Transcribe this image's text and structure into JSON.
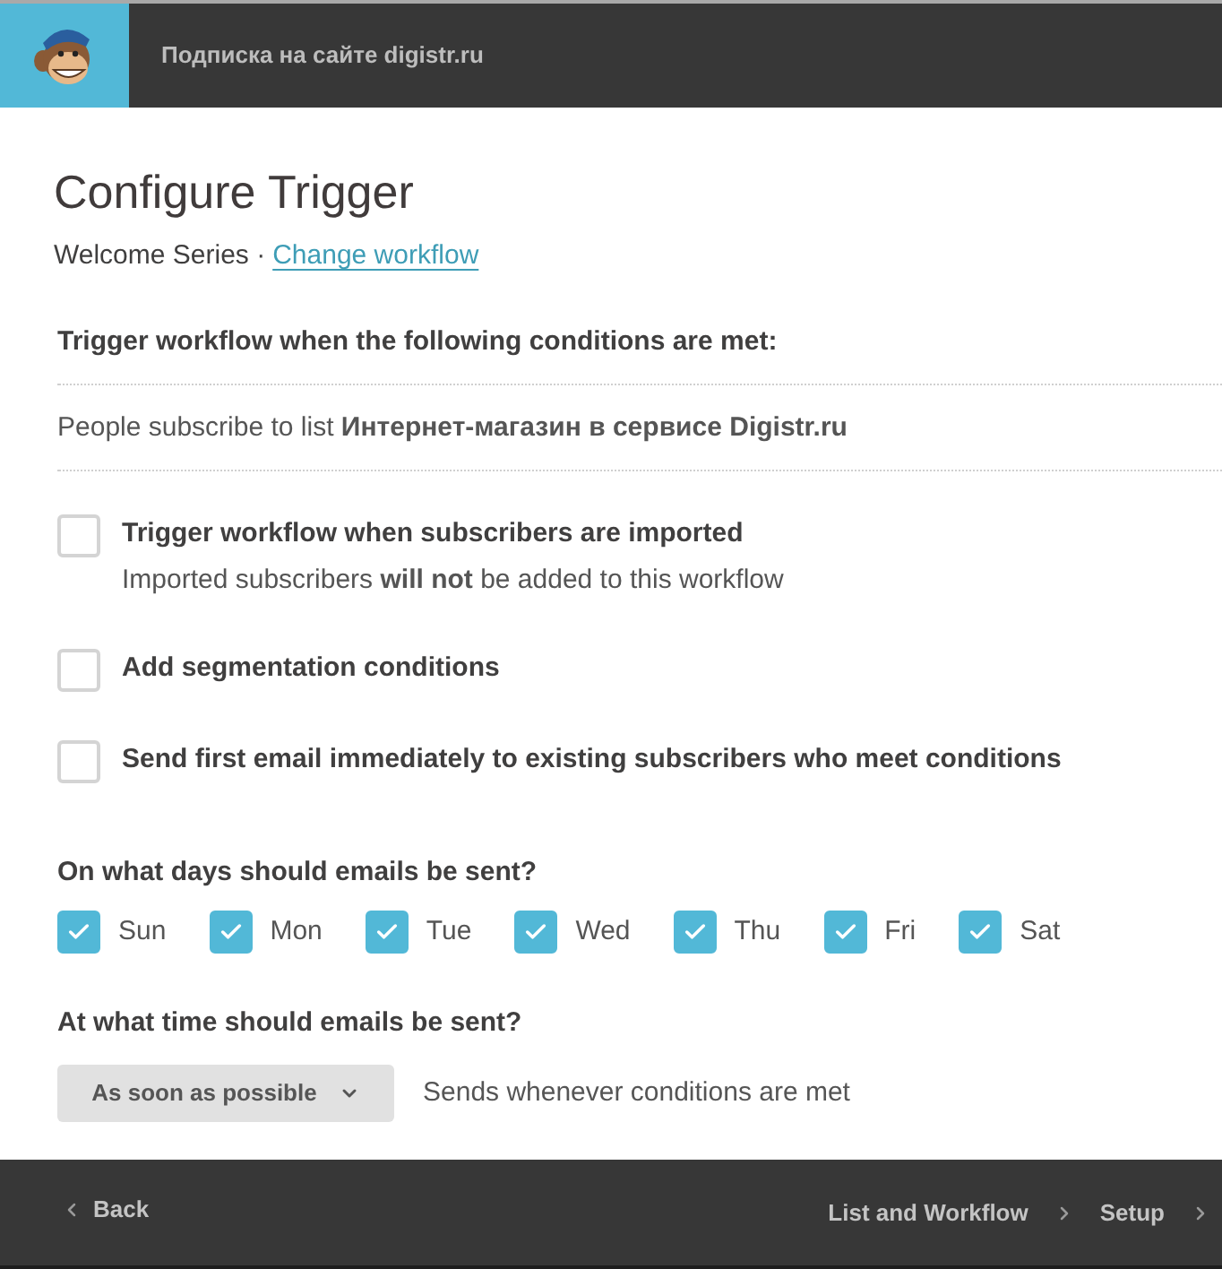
{
  "header": {
    "title": "Подписка на сайте digistr.ru"
  },
  "page": {
    "title": "Configure Trigger",
    "subtitle": "Welcome Series ·",
    "link": "Change workflow"
  },
  "conditions": {
    "heading": "Trigger workflow when the following conditions are met:",
    "trigger": "People subscribe to list **Интернет-магазин в сервисе Digistr.ru**"
  },
  "options": [
    {
      "label": "Trigger workflow when subscribers are imported",
      "note": "Imported subscribers **will not** be added to this workflow",
      "checked": false
    },
    {
      "label": "Add segmentation conditions",
      "checked": false
    },
    {
      "label": "Send first email immediately to existing subscribers who meet conditions",
      "checked": false
    }
  ],
  "days": {
    "question": "On what days should emails be sent?",
    "items": [
      {
        "label": "Sun",
        "checked": true
      },
      {
        "label": "Mon",
        "checked": true
      },
      {
        "label": "Tue",
        "checked": true
      },
      {
        "label": "Wed",
        "checked": true
      },
      {
        "label": "Thu",
        "checked": true
      },
      {
        "label": "Fri",
        "checked": true
      },
      {
        "label": "Sat",
        "checked": true
      }
    ]
  },
  "timing": {
    "question": "At what time should emails be sent?",
    "select": {
      "value": "As soon as possible"
    },
    "hint": "Sends whenever conditions are met"
  },
  "footer": {
    "back": "Back",
    "steps": [
      {
        "label": "List and Workflow"
      },
      {
        "label": "Setup"
      }
    ]
  }
}
